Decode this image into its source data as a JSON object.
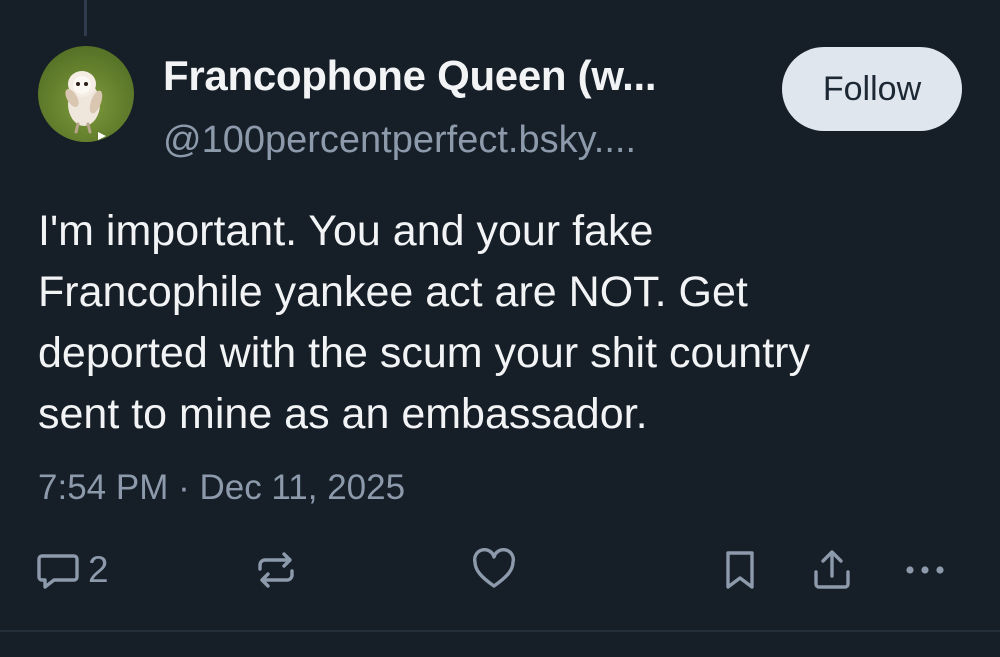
{
  "post": {
    "display_name": "Francophone Queen (w...",
    "handle": "@100percentperfect.bsky....",
    "follow_label": "Follow",
    "text_lines": [
      "I'm important. You and your fake",
      "Francophile yankee act are NOT. Get",
      "deported with the scum your shit country",
      "sent to mine as an embassador."
    ],
    "timestamp": "7:54 PM · Dec 11, 2025",
    "reply_count": "2"
  },
  "icons": {
    "reply": "speech-bubble-icon",
    "repost": "repost-arrows-icon",
    "like": "heart-icon",
    "bookmark": "bookmark-icon",
    "share": "share-upload-icon",
    "more": "more-dots-icon"
  },
  "colors": {
    "background": "#161e27",
    "text_primary": "#f1f3f5",
    "text_secondary": "#8c9aab",
    "follow_button_bg": "#e0e6ee",
    "follow_button_text": "#1d2835"
  }
}
